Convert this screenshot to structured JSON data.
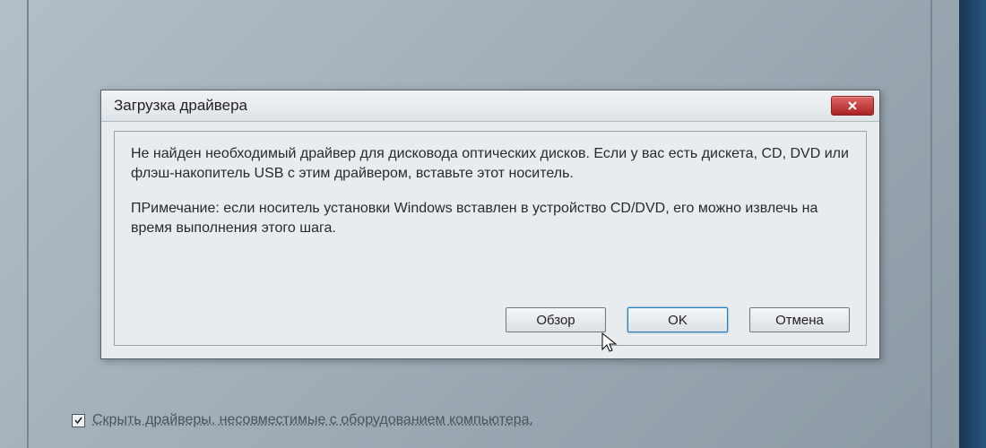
{
  "dialog": {
    "title": "Загрузка драйвера",
    "message1": "Не найден необходимый драйвер для дисковода оптических дисков. Если у вас есть дискета, CD, DVD или флэш-накопитель USB с этим драйвером, вставьте этот носитель.",
    "message2": "ПРимечание: если носитель установки Windows вставлен в устройство CD/DVD, его можно извлечь на время выполнения этого шага.",
    "buttons": {
      "browse": "Обзор",
      "ok": "OK",
      "cancel": "Отмена"
    }
  },
  "checkbox": {
    "checked": true,
    "label": "Скрыть драйверы, несовместимые с оборудованием компьютера."
  }
}
